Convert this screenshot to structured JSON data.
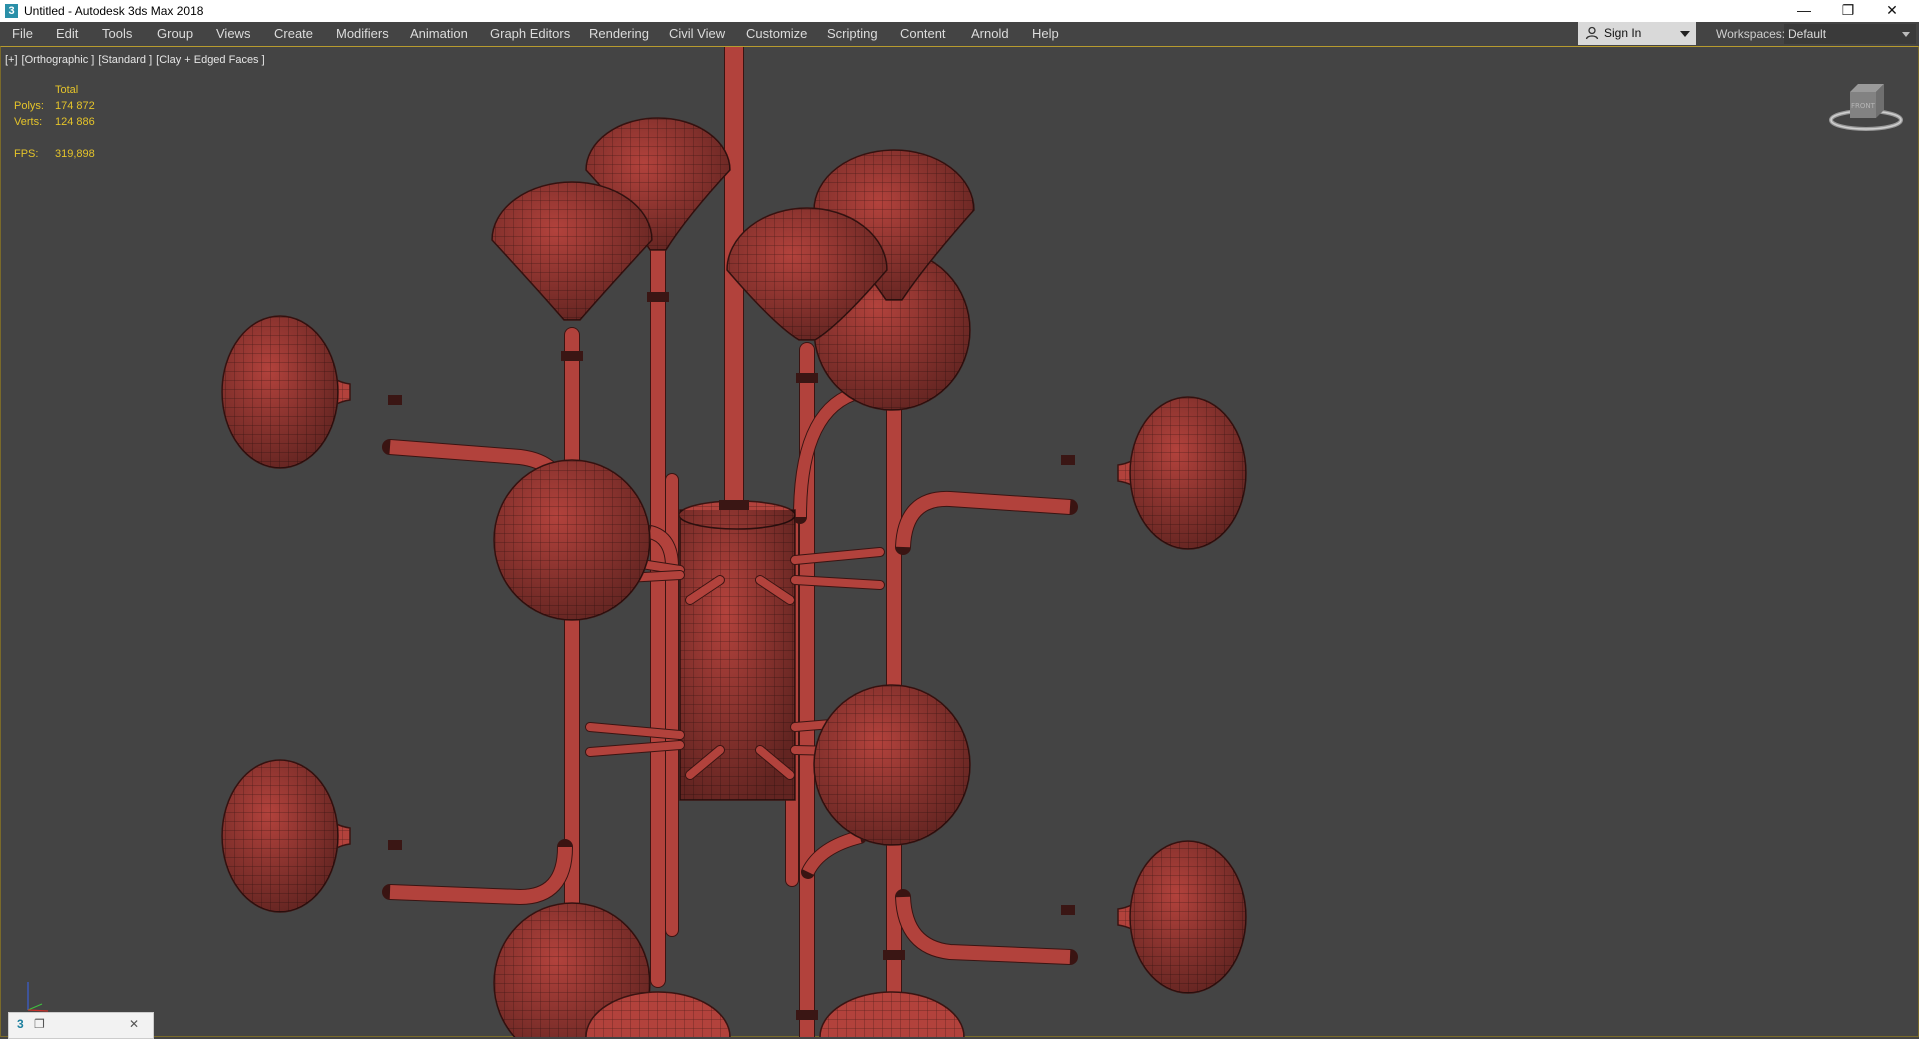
{
  "window": {
    "title": "Untitled - Autodesk 3ds Max 2018",
    "app_icon_glyph": "3",
    "minimize_glyph": "—",
    "restore_glyph": "❐",
    "close_glyph": "✕"
  },
  "menu": {
    "items": [
      {
        "label": "File"
      },
      {
        "label": "Edit"
      },
      {
        "label": "Tools"
      },
      {
        "label": "Group"
      },
      {
        "label": "Views"
      },
      {
        "label": "Create"
      },
      {
        "label": "Modifiers"
      },
      {
        "label": "Animation"
      },
      {
        "label": "Graph Editors"
      },
      {
        "label": "Rendering"
      },
      {
        "label": "Civil View"
      },
      {
        "label": "Customize"
      },
      {
        "label": "Scripting"
      },
      {
        "label": "Content"
      },
      {
        "label": "Arnold"
      },
      {
        "label": "Help"
      }
    ],
    "sign_in": "Sign In",
    "workspaces_label": "Workspaces:",
    "workspace_value": "Default"
  },
  "viewport": {
    "labels": [
      "[+]",
      "[Orthographic ]",
      "[Standard ]",
      "[Clay + Edged Faces ]"
    ],
    "stats": {
      "header": "Total",
      "polys_label": "Polys:",
      "polys_value": "174 872",
      "verts_label": "Verts:",
      "verts_value": "124 886",
      "fps_label": "FPS:",
      "fps_value": "319,898"
    },
    "viewcube_face": "FRONT",
    "model_color": "#b2423c",
    "wire_color": "#3a1412"
  },
  "taskbar_mini": {
    "icon_glyph": "3",
    "close_glyph": "✕"
  }
}
